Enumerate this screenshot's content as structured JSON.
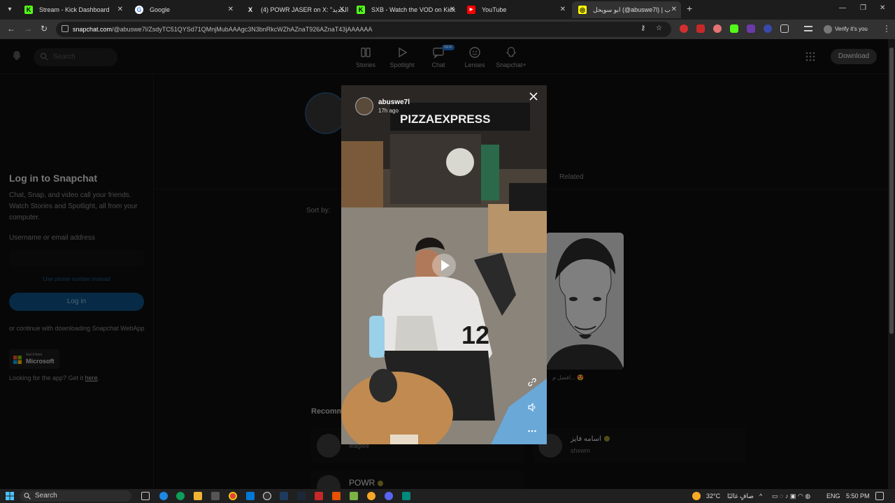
{
  "browser": {
    "tabs": [
      {
        "title": "Stream - Kick Dashboard",
        "icon": "kick-icon",
        "color": "#53fc18"
      },
      {
        "title": "Google",
        "icon": "google-icon",
        "color": "#ffffff"
      },
      {
        "title": "(4) POWR JASER on X: \"الجديد...",
        "icon": "x-icon",
        "color": "#ffffff"
      },
      {
        "title": "SXB - Watch the VOD on Kick",
        "icon": "kick-icon",
        "color": "#53fc18"
      },
      {
        "title": "YouTube",
        "icon": "youtube-icon",
        "color": "#ff0000"
      },
      {
        "title": "ابو سويحل (@abuswe7l) | ب",
        "icon": "snapchat-icon",
        "color": "#fffc00"
      }
    ],
    "url_host": "snapchat.com",
    "url_path": "/@abuswe7l/ZsdyTC51QYSd71QMnjMubAAAgc3N3bnRkcWZhAZnaT926AZnaT43jAAAAAA",
    "profile_label": "Verify it's you"
  },
  "snapchat": {
    "search_placeholder": "Search",
    "nav": [
      {
        "label": "Stories",
        "icon": "stories-icon"
      },
      {
        "label": "Spotlight",
        "icon": "spotlight-icon"
      },
      {
        "label": "Chat",
        "icon": "chat-icon",
        "badge": "NEW"
      },
      {
        "label": "Lenses",
        "icon": "lenses-icon"
      },
      {
        "label": "Snapchat+",
        "icon": "snapchat-plus-icon"
      }
    ],
    "download_label": "Download",
    "login": {
      "title": "Log in to Snapchat",
      "subtitle": "Chat, Snap, and video call your friends. Watch Stories and Spotlight, all from your computer.",
      "username_label": "Username or email address",
      "phone_link": "Use phone number instead",
      "login_button": "Log in",
      "continue_text": "or continue with downloading Snapchat WebApp",
      "ms_small": "Get it from",
      "ms_big": "Microsoft",
      "app_text": "Looking for the app? Get it ",
      "app_link": "here",
      "app_suffix": "."
    },
    "related_tab": "Related",
    "sort_by": "Sort by:",
    "bg_caption": "افضل م... 😍",
    "recommended_label": "Recomm",
    "recommended": [
      {
        "name": "",
        "username": "leaglee"
      },
      {
        "name": "اسامه فايز",
        "username": "shxwm"
      },
      {
        "name": "POWR",
        "username": ""
      }
    ]
  },
  "story": {
    "username": "abuswe7l",
    "time": "17h ago",
    "sign_text": "PIZZAEXPRESS",
    "jersey_number": "12"
  },
  "taskbar": {
    "search_label": "Search",
    "weather": "32°C",
    "weather_text": "صافٍ غالبًا",
    "lang": "ENG",
    "time": "5:50 PM"
  }
}
